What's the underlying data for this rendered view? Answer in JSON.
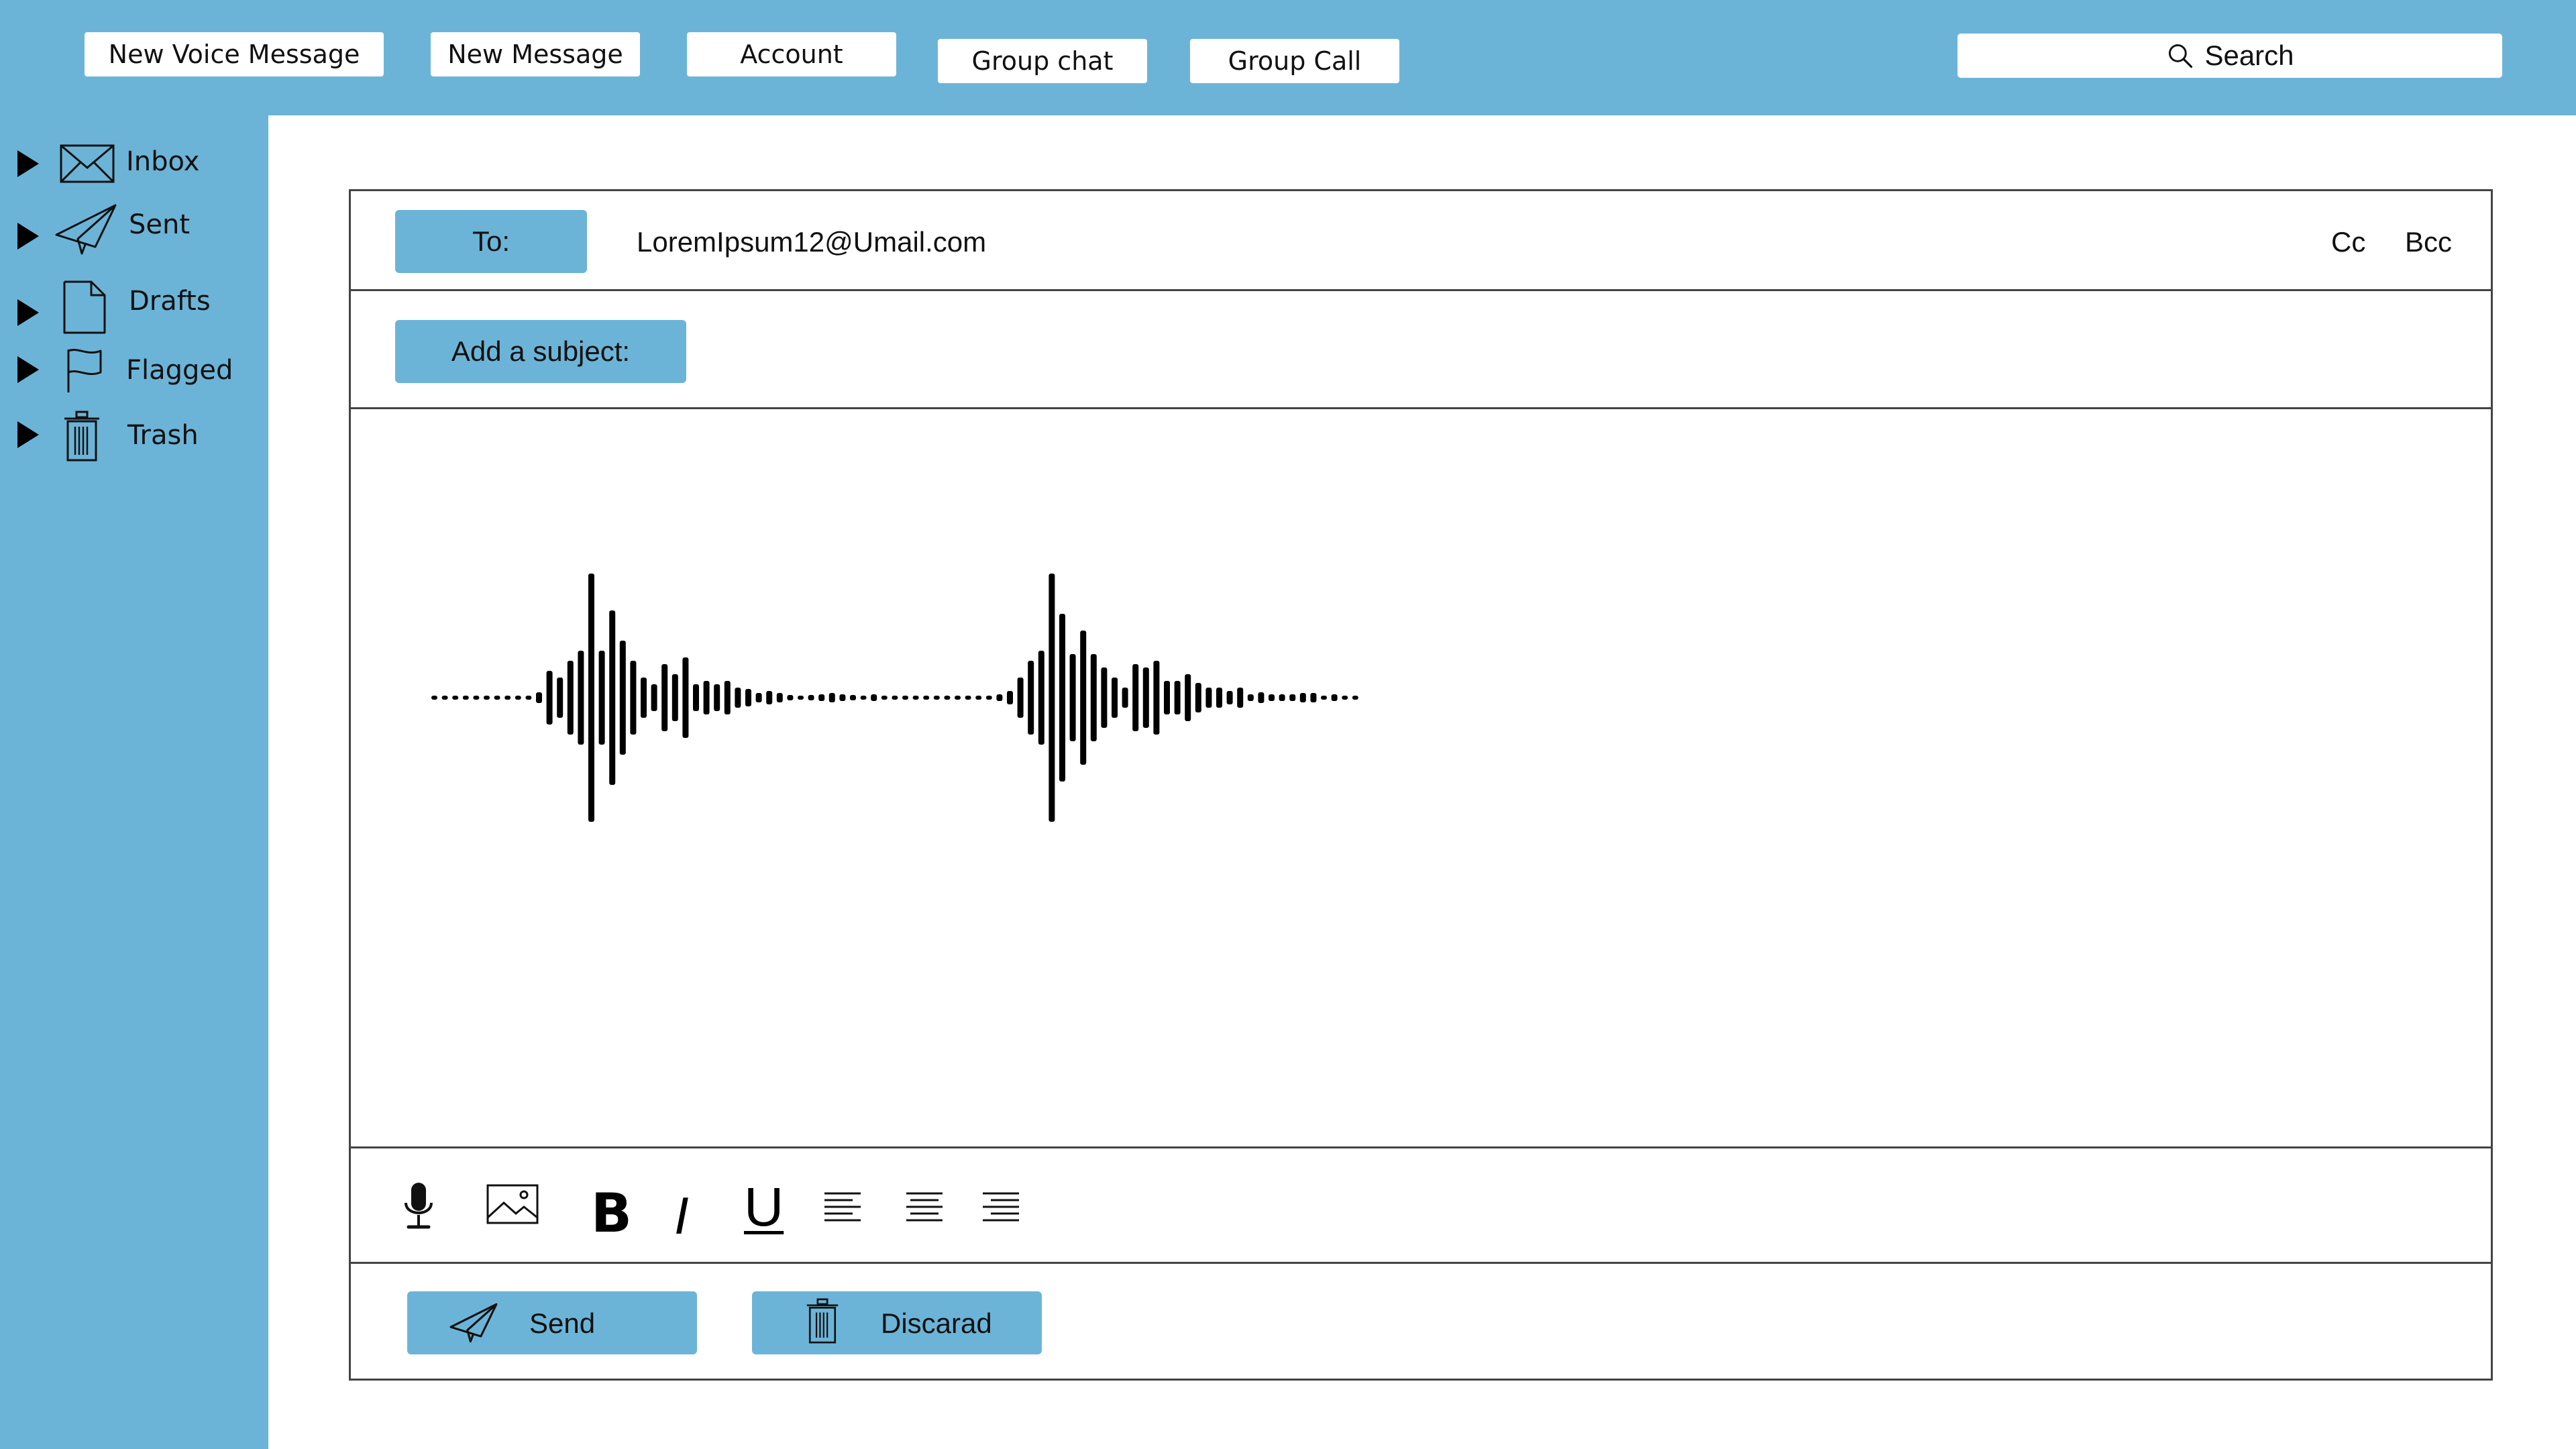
{
  "toolbar": {
    "new_voice_message": "New  Voice Message",
    "new_message": "New Message",
    "account": "Account",
    "group_chat": "Group chat",
    "group_call": "Group Call",
    "search_placeholder": "Search"
  },
  "sidebar": {
    "items": [
      {
        "label": "Inbox",
        "icon": "envelope-icon"
      },
      {
        "label": "Sent",
        "icon": "paper-plane-icon"
      },
      {
        "label": "Drafts",
        "icon": "document-icon"
      },
      {
        "label": "Flagged",
        "icon": "flag-icon"
      },
      {
        "label": "Trash",
        "icon": "trash-icon"
      }
    ]
  },
  "compose": {
    "to_label": "To:",
    "to_value": "LoremIpsum12@Umail.com",
    "cc_label": "Cc",
    "bcc_label": "Bcc",
    "subject_label": "Add a subject:",
    "format": {
      "bold": "B",
      "italic": "I",
      "underline": "U"
    },
    "send_label": "Send",
    "discard_label": "Discarad"
  },
  "colors": {
    "accent": "#6cb4d7",
    "background": "#ffffff",
    "text": "#111111"
  }
}
